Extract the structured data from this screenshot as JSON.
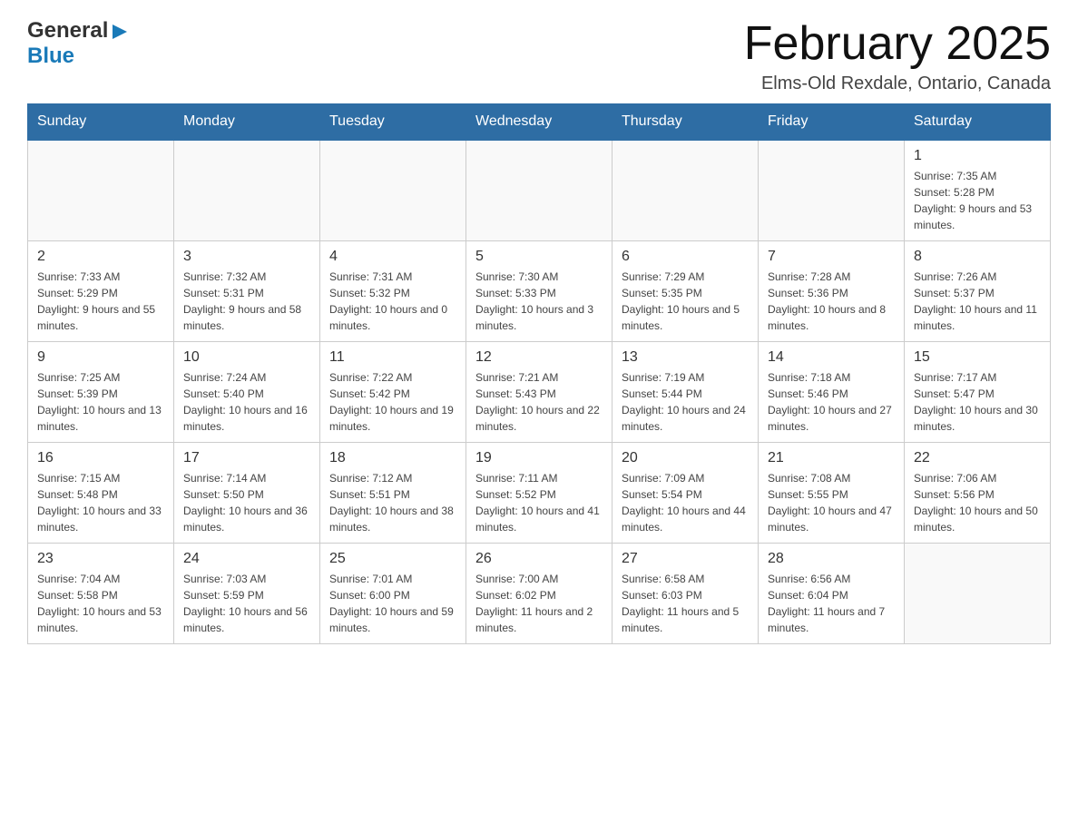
{
  "header": {
    "logo": {
      "general": "General",
      "blue": "Blue"
    },
    "title": "February 2025",
    "subtitle": "Elms-Old Rexdale, Ontario, Canada"
  },
  "days_of_week": [
    "Sunday",
    "Monday",
    "Tuesday",
    "Wednesday",
    "Thursday",
    "Friday",
    "Saturday"
  ],
  "weeks": [
    {
      "days": [
        {
          "date": "",
          "info": ""
        },
        {
          "date": "",
          "info": ""
        },
        {
          "date": "",
          "info": ""
        },
        {
          "date": "",
          "info": ""
        },
        {
          "date": "",
          "info": ""
        },
        {
          "date": "",
          "info": ""
        },
        {
          "date": "1",
          "info": "Sunrise: 7:35 AM\nSunset: 5:28 PM\nDaylight: 9 hours and 53 minutes."
        }
      ]
    },
    {
      "days": [
        {
          "date": "2",
          "info": "Sunrise: 7:33 AM\nSunset: 5:29 PM\nDaylight: 9 hours and 55 minutes."
        },
        {
          "date": "3",
          "info": "Sunrise: 7:32 AM\nSunset: 5:31 PM\nDaylight: 9 hours and 58 minutes."
        },
        {
          "date": "4",
          "info": "Sunrise: 7:31 AM\nSunset: 5:32 PM\nDaylight: 10 hours and 0 minutes."
        },
        {
          "date": "5",
          "info": "Sunrise: 7:30 AM\nSunset: 5:33 PM\nDaylight: 10 hours and 3 minutes."
        },
        {
          "date": "6",
          "info": "Sunrise: 7:29 AM\nSunset: 5:35 PM\nDaylight: 10 hours and 5 minutes."
        },
        {
          "date": "7",
          "info": "Sunrise: 7:28 AM\nSunset: 5:36 PM\nDaylight: 10 hours and 8 minutes."
        },
        {
          "date": "8",
          "info": "Sunrise: 7:26 AM\nSunset: 5:37 PM\nDaylight: 10 hours and 11 minutes."
        }
      ]
    },
    {
      "days": [
        {
          "date": "9",
          "info": "Sunrise: 7:25 AM\nSunset: 5:39 PM\nDaylight: 10 hours and 13 minutes."
        },
        {
          "date": "10",
          "info": "Sunrise: 7:24 AM\nSunset: 5:40 PM\nDaylight: 10 hours and 16 minutes."
        },
        {
          "date": "11",
          "info": "Sunrise: 7:22 AM\nSunset: 5:42 PM\nDaylight: 10 hours and 19 minutes."
        },
        {
          "date": "12",
          "info": "Sunrise: 7:21 AM\nSunset: 5:43 PM\nDaylight: 10 hours and 22 minutes."
        },
        {
          "date": "13",
          "info": "Sunrise: 7:19 AM\nSunset: 5:44 PM\nDaylight: 10 hours and 24 minutes."
        },
        {
          "date": "14",
          "info": "Sunrise: 7:18 AM\nSunset: 5:46 PM\nDaylight: 10 hours and 27 minutes."
        },
        {
          "date": "15",
          "info": "Sunrise: 7:17 AM\nSunset: 5:47 PM\nDaylight: 10 hours and 30 minutes."
        }
      ]
    },
    {
      "days": [
        {
          "date": "16",
          "info": "Sunrise: 7:15 AM\nSunset: 5:48 PM\nDaylight: 10 hours and 33 minutes."
        },
        {
          "date": "17",
          "info": "Sunrise: 7:14 AM\nSunset: 5:50 PM\nDaylight: 10 hours and 36 minutes."
        },
        {
          "date": "18",
          "info": "Sunrise: 7:12 AM\nSunset: 5:51 PM\nDaylight: 10 hours and 38 minutes."
        },
        {
          "date": "19",
          "info": "Sunrise: 7:11 AM\nSunset: 5:52 PM\nDaylight: 10 hours and 41 minutes."
        },
        {
          "date": "20",
          "info": "Sunrise: 7:09 AM\nSunset: 5:54 PM\nDaylight: 10 hours and 44 minutes."
        },
        {
          "date": "21",
          "info": "Sunrise: 7:08 AM\nSunset: 5:55 PM\nDaylight: 10 hours and 47 minutes."
        },
        {
          "date": "22",
          "info": "Sunrise: 7:06 AM\nSunset: 5:56 PM\nDaylight: 10 hours and 50 minutes."
        }
      ]
    },
    {
      "days": [
        {
          "date": "23",
          "info": "Sunrise: 7:04 AM\nSunset: 5:58 PM\nDaylight: 10 hours and 53 minutes."
        },
        {
          "date": "24",
          "info": "Sunrise: 7:03 AM\nSunset: 5:59 PM\nDaylight: 10 hours and 56 minutes."
        },
        {
          "date": "25",
          "info": "Sunrise: 7:01 AM\nSunset: 6:00 PM\nDaylight: 10 hours and 59 minutes."
        },
        {
          "date": "26",
          "info": "Sunrise: 7:00 AM\nSunset: 6:02 PM\nDaylight: 11 hours and 2 minutes."
        },
        {
          "date": "27",
          "info": "Sunrise: 6:58 AM\nSunset: 6:03 PM\nDaylight: 11 hours and 5 minutes."
        },
        {
          "date": "28",
          "info": "Sunrise: 6:56 AM\nSunset: 6:04 PM\nDaylight: 11 hours and 7 minutes."
        },
        {
          "date": "",
          "info": ""
        }
      ]
    }
  ]
}
